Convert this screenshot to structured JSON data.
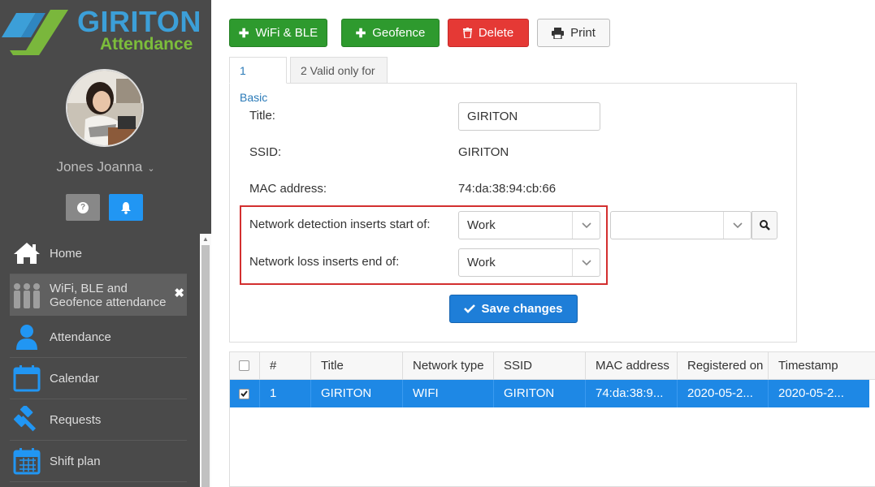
{
  "app": {
    "name": "GIRITON",
    "subtitle": "Attendance"
  },
  "user": {
    "name": "Jones Joanna"
  },
  "sidebar": {
    "buttons": {
      "help": "?",
      "notifications": "bell"
    },
    "items": [
      {
        "label": "Home",
        "icon": "home-icon"
      },
      {
        "label": "WiFi, BLE and",
        "label2": "Geofence attendance",
        "icon": "group-icon"
      },
      {
        "label": "Attendance",
        "icon": "user-icon"
      },
      {
        "label": "Calendar",
        "icon": "calendar-icon"
      },
      {
        "label": "Requests",
        "icon": "gavel-icon"
      },
      {
        "label": "Shift plan",
        "icon": "shift-plan-icon"
      }
    ],
    "close_label": "✖"
  },
  "toolbar": {
    "wifi_label": "WiFi & BLE",
    "geofence_label": "Geofence",
    "delete_label": "Delete",
    "print_label": "Print"
  },
  "tabs": [
    {
      "label": "1 Basic"
    },
    {
      "label": "2 Valid only for"
    }
  ],
  "form": {
    "title_label": "Title:",
    "title_value": "GIRITON",
    "ssid_label": "SSID:",
    "ssid_value": "GIRITON",
    "mac_label": "MAC address:",
    "mac_value": "74:da:38:94:cb:66",
    "start_label": "Network detection inserts start of:",
    "start_value": "Work",
    "end_label": "Network loss inserts end of:",
    "end_value": "Work",
    "extra_value": "",
    "save_label": "Save changes"
  },
  "table": {
    "headers": [
      "#",
      "Title",
      "Network type",
      "SSID",
      "MAC address",
      "Registered on",
      "Timestamp"
    ],
    "rows": [
      [
        "1",
        "GIRITON",
        "WIFI",
        "GIRITON",
        "74:da:38:9...",
        "2020-05-2...",
        "2020-05-2..."
      ]
    ]
  },
  "colors": {
    "accent": "#1e88e5",
    "success": "#2e9a2e",
    "danger": "#e53935",
    "highlight": "#d32f2f"
  }
}
